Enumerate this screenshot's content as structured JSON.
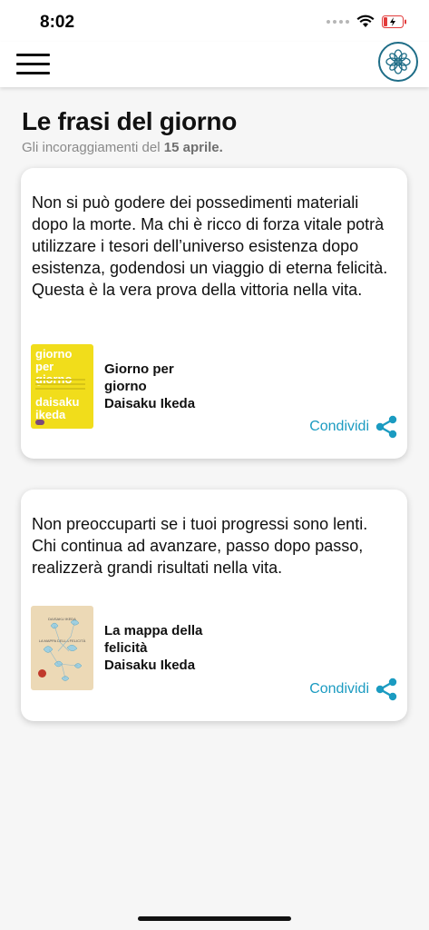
{
  "status": {
    "time": "8:02"
  },
  "header": {
    "title": "Le frasi del giorno",
    "subtitle_prefix": "Gli incoraggiamenti del",
    "subtitle_date": "15 aprile."
  },
  "cards": [
    {
      "quote": "Non si può godere dei possedimenti materiali dopo la morte. Ma chi è ricco di forza vitale potrà utilizzare i tesori dell’universo esistenza dopo esistenza, godendosi un viaggio di eterna felicità. Questa è la vera prova della vittoria nella vita.",
      "book_title": "Giorno per giorno",
      "book_author": "Daisaku Ikeda",
      "cover": {
        "title_line1": "giorno",
        "title_line2": "per giorno",
        "author_line1": "daisaku",
        "author_line2": "ikeda"
      },
      "share_label": "Condividi"
    },
    {
      "quote": "Non preoccuparti se i tuoi progressi sono lenti. Chi continua ad avanzare, passo dopo passo, realizzerà grandi risultati nella vita.",
      "book_title": "La mappa della felicità",
      "book_author": "Daisaku Ikeda",
      "cover": {
        "top_text": "DAISAKU IKEDA",
        "title_text": "LA MAPPA DELLA FELICITÀ"
      },
      "share_label": "Condividi"
    }
  ],
  "colors": {
    "accent": "#1b9bc1",
    "logo": "#1e6d87",
    "cover_yellow": "#f1dd1b",
    "cover_beige": "#ecd9b6"
  },
  "icons": {
    "menu": "hamburger-menu-icon",
    "logo": "mandala-logo-icon",
    "share": "share-icon"
  }
}
